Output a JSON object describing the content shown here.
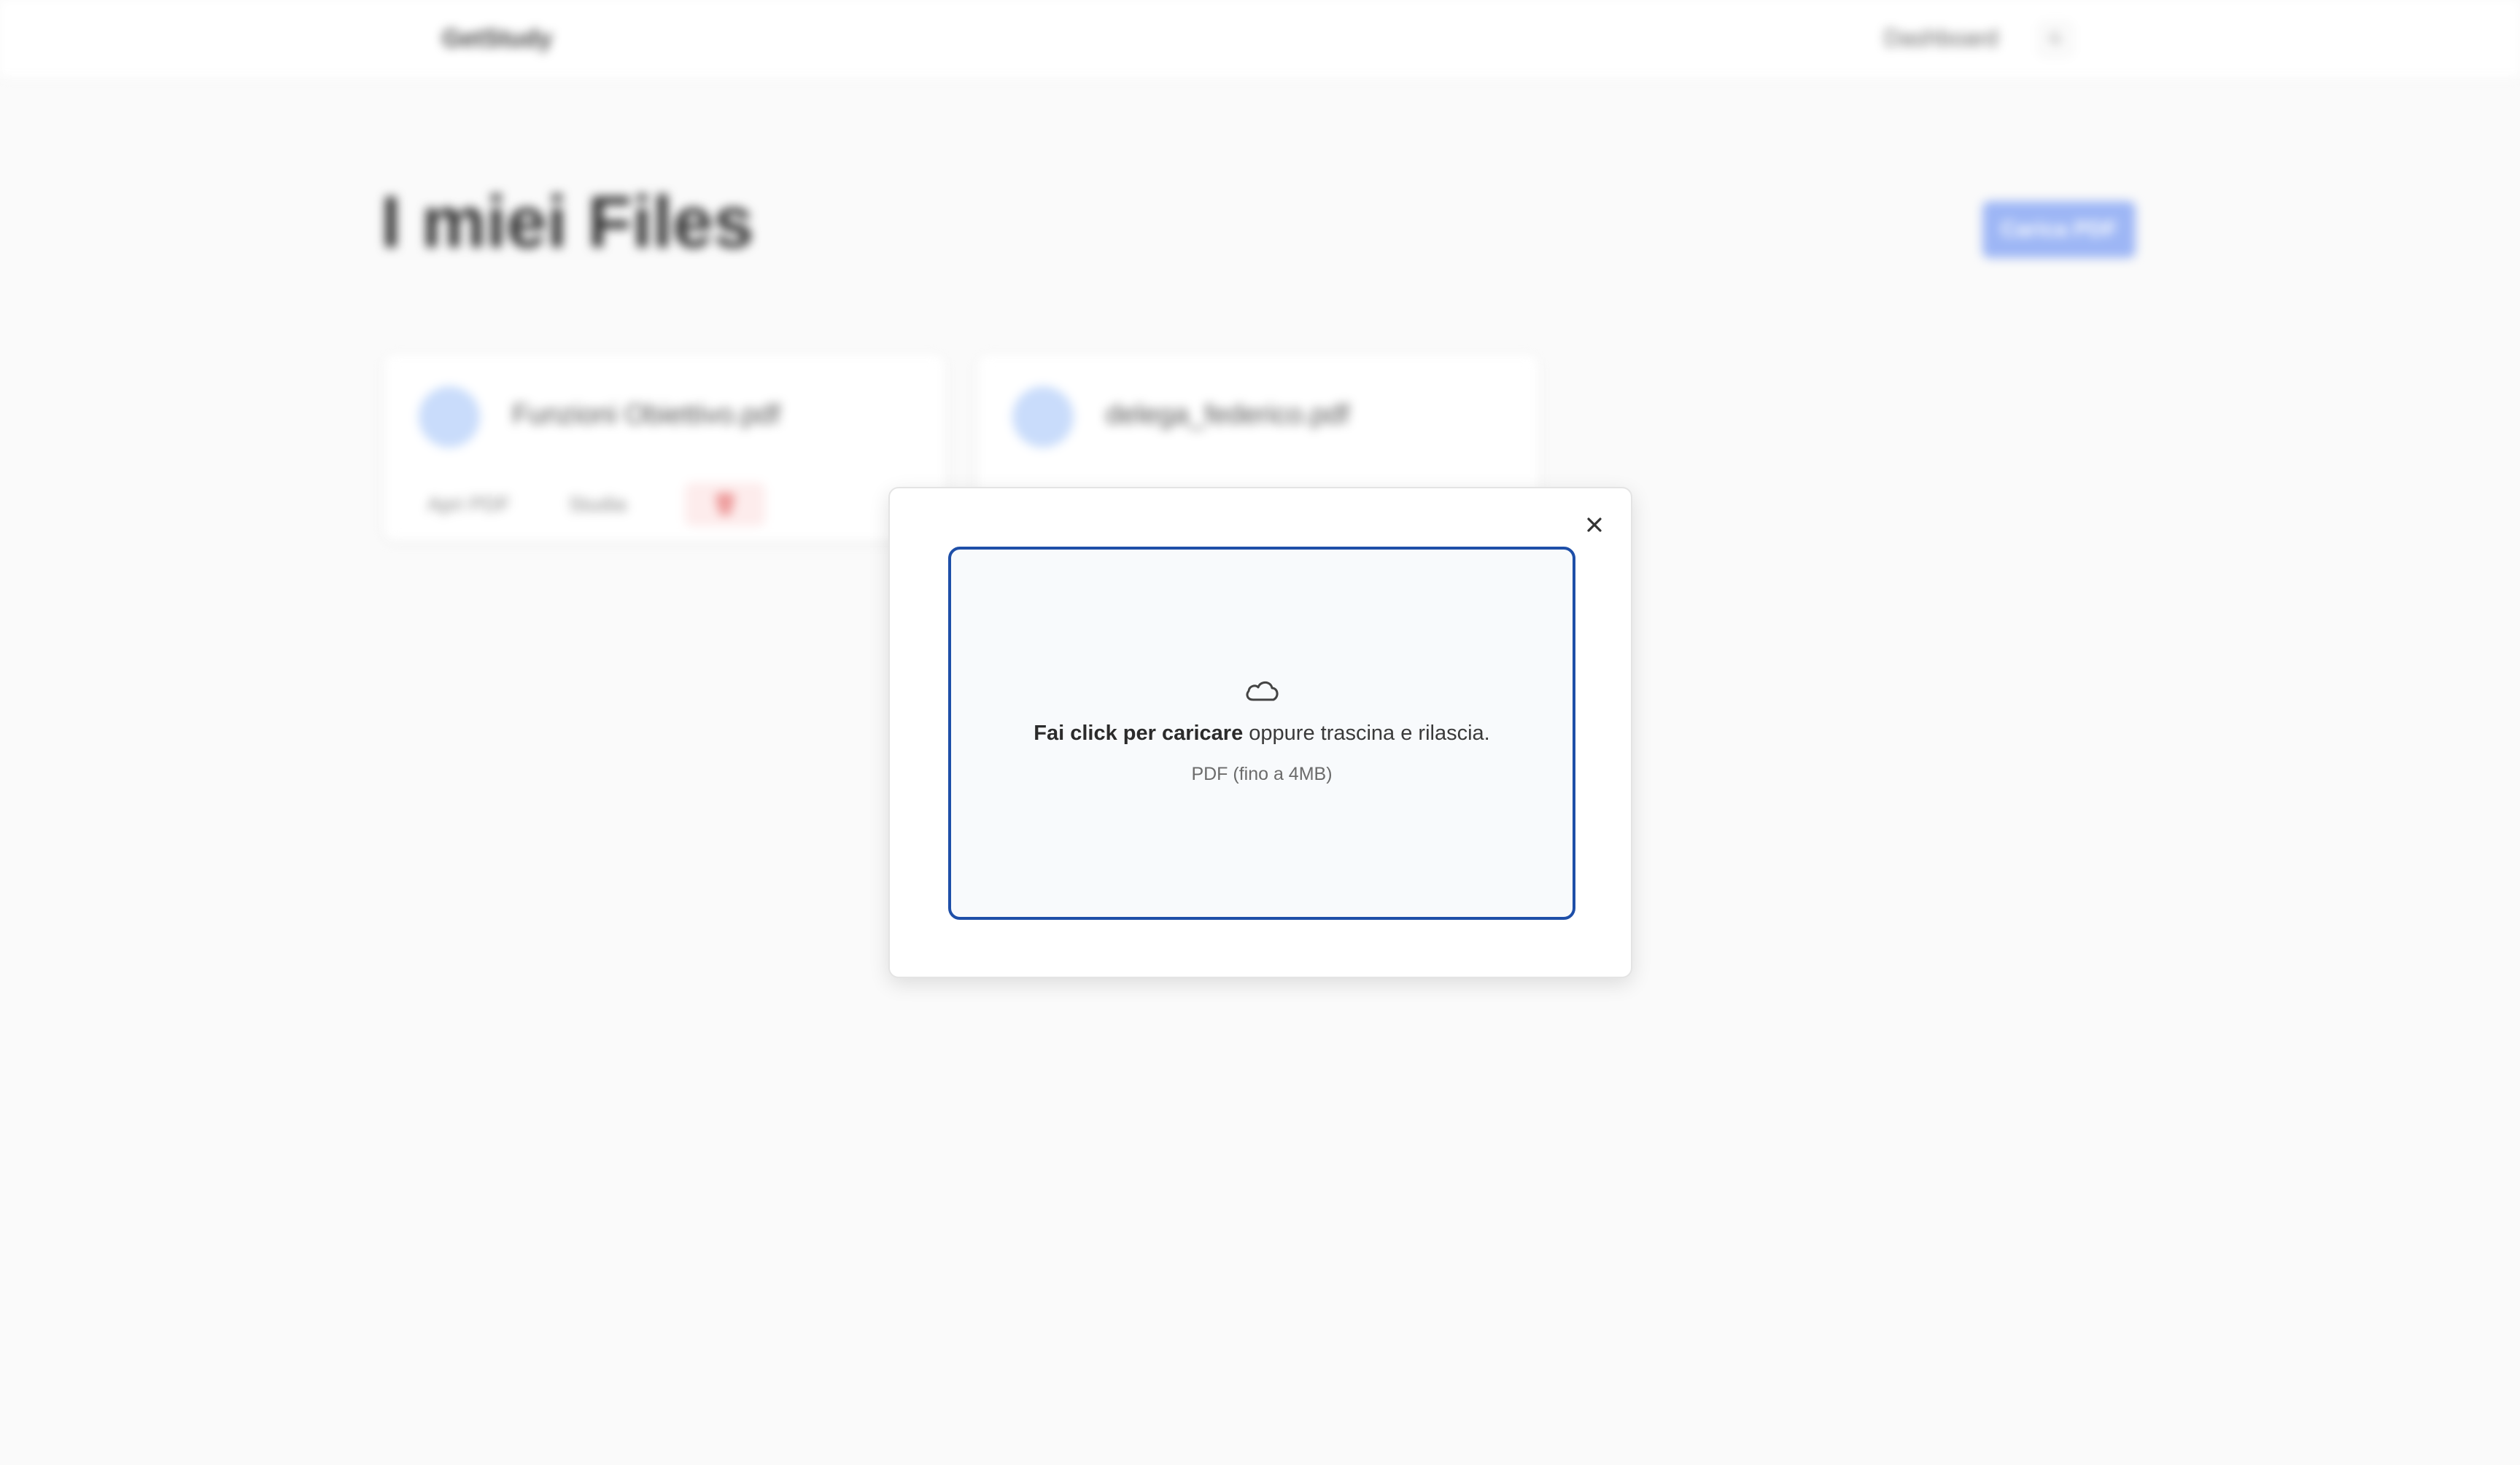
{
  "topbar": {
    "brand": "GetStudy",
    "nav_dashboard": "Dashboard",
    "avatar_initial": "G"
  },
  "page": {
    "title": "I miei Files",
    "upload_button": "Carica PDF"
  },
  "files": [
    {
      "name": "Funzioni Obiettivo.pdf",
      "action_open": "Apri PDF",
      "action_study": "Studia",
      "delete_icon": "trash-icon"
    },
    {
      "name": "delega_federico.pdf"
    }
  ],
  "modal": {
    "close_icon": "close-icon",
    "upload_icon": "cloud-icon",
    "drop_strong": "Fai click per caricare",
    "drop_rest": " oppure trascina e rilascia.",
    "drop_hint": "PDF (fino a 4MB)",
    "accent_color": "#1e4fa8"
  }
}
